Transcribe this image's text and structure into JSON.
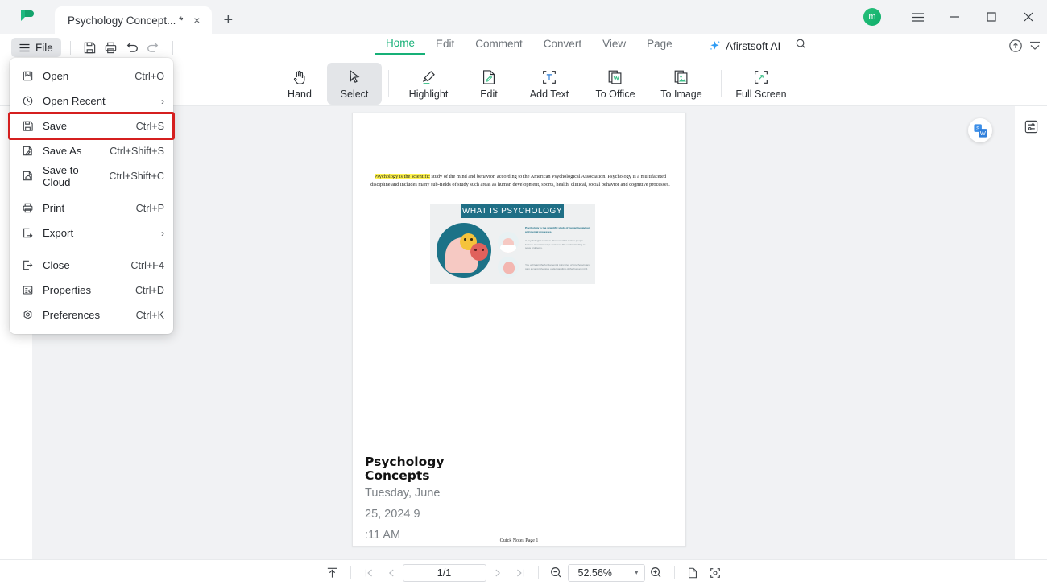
{
  "window": {
    "app_logo": "afirstsoft-logo",
    "tab": {
      "label": "Psychology Concept... *",
      "close": "×"
    },
    "new_tab": "+",
    "avatar_initial": "m",
    "controls": {
      "menu": "hamburger-menu",
      "minimize": "—",
      "maximize": "□",
      "close": "✕"
    }
  },
  "menubar": {
    "file_label": "File",
    "quick_access": [
      "save-icon",
      "print-icon",
      "undo-icon",
      "redo-icon"
    ]
  },
  "ribbon": {
    "tabs": [
      {
        "label": "Home",
        "active": true
      },
      {
        "label": "Edit",
        "active": false
      },
      {
        "label": "Comment",
        "active": false
      },
      {
        "label": "Convert",
        "active": false
      },
      {
        "label": "View",
        "active": false
      },
      {
        "label": "Page",
        "active": false
      }
    ],
    "ai_label": "Afirstsoft AI",
    "accent_color": "#16b077"
  },
  "tools": [
    {
      "label": "Hand",
      "icon": "hand-icon",
      "active": false
    },
    {
      "label": "Select",
      "icon": "cursor-icon",
      "active": true
    },
    {
      "label": "Highlight",
      "icon": "highlighter-icon",
      "active": false
    },
    {
      "label": "Edit",
      "icon": "edit-document-icon",
      "active": false
    },
    {
      "label": "Add Text",
      "icon": "add-text-icon",
      "active": false
    },
    {
      "label": "To Office",
      "icon": "to-office-icon",
      "active": false
    },
    {
      "label": "To Image",
      "icon": "to-image-icon",
      "active": false
    },
    {
      "label": "Full Screen",
      "icon": "full-screen-icon",
      "active": false
    }
  ],
  "file_menu": {
    "items": [
      {
        "label": "Open",
        "shortcut": "Ctrl+O",
        "icon": "open-file-icon",
        "submenu": false,
        "highlighted": false
      },
      {
        "label": "Open Recent",
        "shortcut": "",
        "icon": "recent-clock-icon",
        "submenu": true,
        "highlighted": false
      },
      {
        "label": "Save",
        "shortcut": "Ctrl+S",
        "icon": "save-disk-icon",
        "submenu": false,
        "highlighted": true
      },
      {
        "label": "Save As",
        "shortcut": "Ctrl+Shift+S",
        "icon": "save-as-icon",
        "submenu": false,
        "highlighted": false
      },
      {
        "label": "Save to Cloud",
        "shortcut": "Ctrl+Shift+C",
        "icon": "save-cloud-icon",
        "submenu": false,
        "highlighted": false
      },
      {
        "label": "Print",
        "shortcut": "Ctrl+P",
        "icon": "printer-icon",
        "submenu": false,
        "highlighted": false
      },
      {
        "label": "Export",
        "shortcut": "",
        "icon": "export-icon",
        "submenu": true,
        "highlighted": false
      },
      {
        "label": "Close",
        "shortcut": "Ctrl+F4",
        "icon": "close-door-icon",
        "submenu": false,
        "highlighted": false
      },
      {
        "label": "Properties",
        "shortcut": "Ctrl+D",
        "icon": "properties-icon",
        "submenu": false,
        "highlighted": false
      },
      {
        "label": "Preferences",
        "shortcut": "Ctrl+K",
        "icon": "preferences-gear-icon",
        "submenu": false,
        "highlighted": false
      }
    ],
    "submenu_arrow": "›",
    "highlight_color": "#d51f1f"
  },
  "document": {
    "paragraph_highlight": "Psychology is the scientific",
    "paragraph_rest": " study of the mind and behavior, according to the American Psychological Association. Psychology is a multifaceted discipline and includes many sub-fields of study such areas as human development, sports, health, clinical, social behavior and cognitive processes.",
    "infographic": {
      "heading": "WHAT IS PSYCHOLOGY",
      "lead": "Psychology is the scientific study of human behaviour and mental processes.",
      "point_1": "A psychologist seeks to discover what makes people behave in certain ways and uses this understanding to solve problems.",
      "point_2": "You will learn the fundamental principles of psychology and gain a comprehensive understanding of the human mind."
    },
    "title": "Psychology Concepts",
    "subtitle_line1": "Tuesday, June",
    "subtitle_line2": "25, 2024   9",
    "subtitle_line3": ":11 AM",
    "footer": "Quick Notes Page 1"
  },
  "overlays": {
    "translate_icon": "translate-word-icon",
    "panel_icon": "properties-panel-icon"
  },
  "statusbar": {
    "fit_icon": "scroll-top-icon",
    "first_page": "first-page-icon",
    "prev_page": "prev-page-icon",
    "page_value": "1/1",
    "next_page": "next-page-icon",
    "last_page": "last-page-icon",
    "zoom_out": "zoom-out-icon",
    "zoom_value": "52.56%",
    "zoom_dropdown": "▾",
    "zoom_in": "zoom-in-icon",
    "single_page_icon": "single-page-view-icon",
    "fit_page_icon": "fit-page-icon"
  }
}
